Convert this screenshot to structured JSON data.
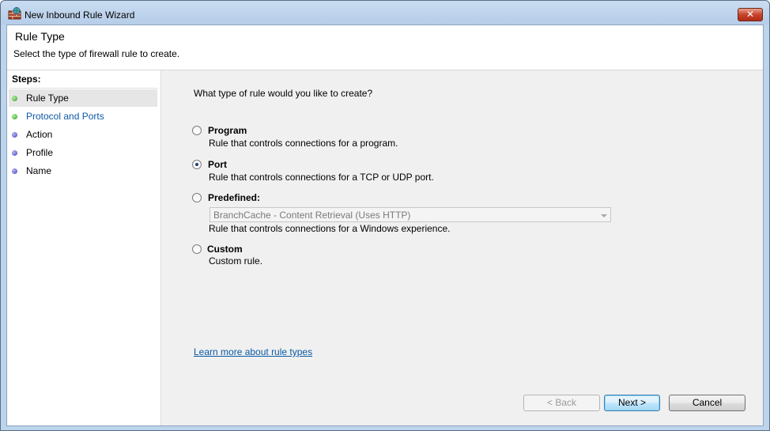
{
  "window": {
    "title": "New Inbound Rule Wizard",
    "close_label": "✕"
  },
  "header": {
    "title": "Rule Type",
    "subtitle": "Select the type of firewall rule to create."
  },
  "steps": {
    "heading": "Steps:",
    "items": [
      {
        "label": "Rule Type",
        "state": "current"
      },
      {
        "label": "Protocol and Ports",
        "state": "link"
      },
      {
        "label": "Action",
        "state": "pending"
      },
      {
        "label": "Profile",
        "state": "pending"
      },
      {
        "label": "Name",
        "state": "pending"
      }
    ]
  },
  "main": {
    "question": "What type of rule would you like to create?",
    "options": [
      {
        "label": "Program",
        "description": "Rule that controls connections for a program."
      },
      {
        "label": "Port",
        "description": "Rule that controls connections for a TCP or UDP port."
      },
      {
        "label": "Predefined:",
        "description": "Rule that controls connections for a Windows experience."
      },
      {
        "label": "Custom",
        "description": "Custom rule."
      }
    ],
    "selected_option": "Port",
    "predefined_value": "BranchCache - Content Retrieval (Uses HTTP)",
    "learn_more": "Learn more about rule types"
  },
  "buttons": {
    "back": "< Back",
    "next": "Next >",
    "cancel": "Cancel"
  },
  "colors": {
    "link": "#0b5aa6",
    "completed_dot": "#2f9a1e",
    "pending_dot": "#3e42b8"
  }
}
